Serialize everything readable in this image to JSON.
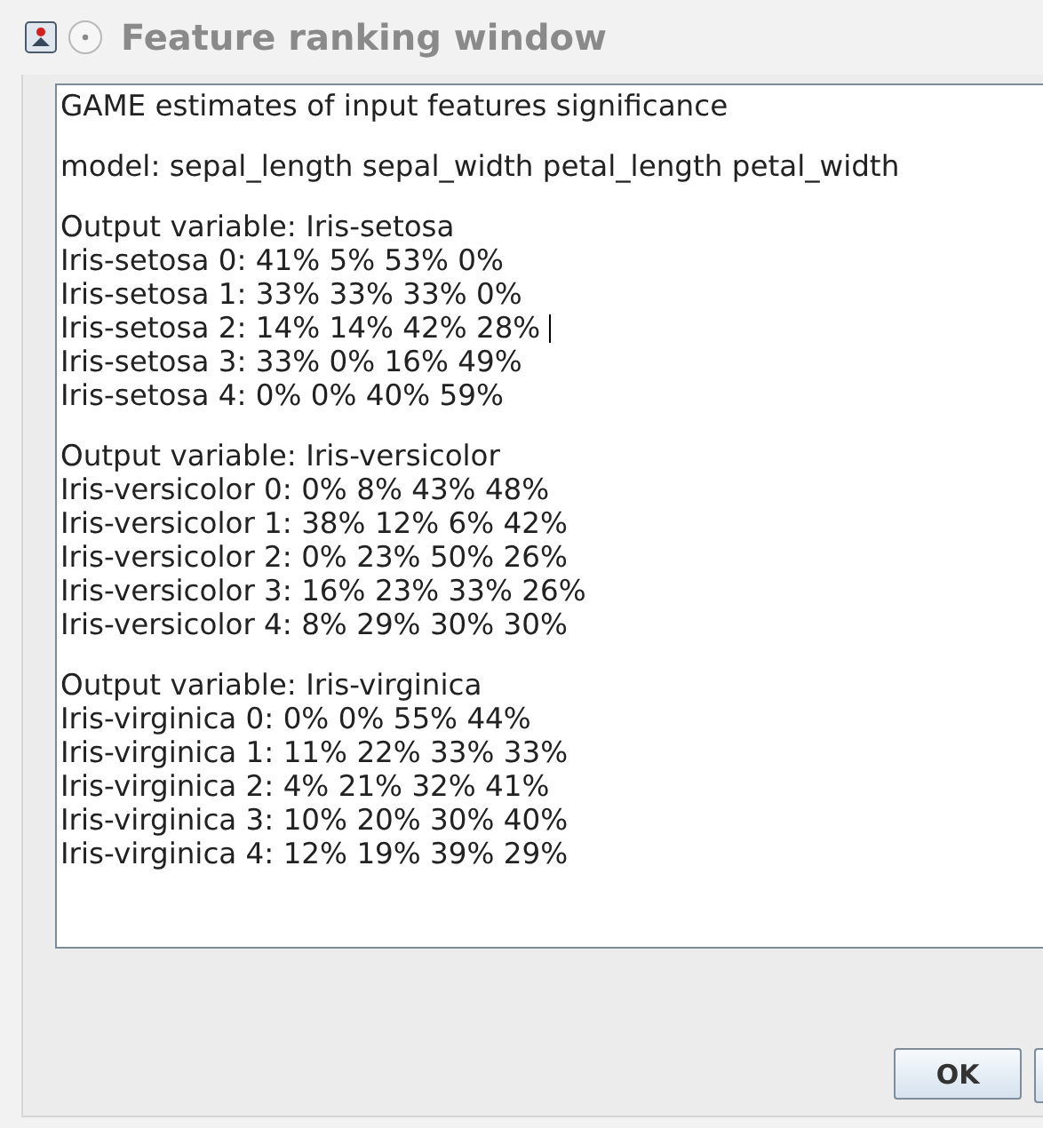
{
  "window": {
    "title": "Feature ranking window"
  },
  "report": {
    "heading": "GAME estimates of input features significance",
    "model": "model: sepal_length sepal_width petal_length petal_width",
    "groups": [
      {
        "title": "Output variable: Iris-setosa",
        "rows": [
          {
            "text": "Iris-setosa 0: 41% 5% 53% 0%",
            "caret": false
          },
          {
            "text": "Iris-setosa 1: 33% 33% 33% 0%",
            "caret": false
          },
          {
            "text": "Iris-setosa 2: 14% 14% 42% 28% ",
            "caret": true
          },
          {
            "text": "Iris-setosa 3: 33% 0% 16% 49%",
            "caret": false
          },
          {
            "text": "Iris-setosa 4: 0% 0% 40% 59%",
            "caret": false
          }
        ]
      },
      {
        "title": "Output variable: Iris-versicolor",
        "rows": [
          {
            "text": "Iris-versicolor 0: 0% 8% 43% 48%",
            "caret": false
          },
          {
            "text": "Iris-versicolor 1: 38% 12% 6% 42%",
            "caret": false
          },
          {
            "text": "Iris-versicolor 2: 0% 23% 50% 26%",
            "caret": false
          },
          {
            "text": "Iris-versicolor 3: 16% 23% 33% 26%",
            "caret": false
          },
          {
            "text": "Iris-versicolor 4: 8% 29% 30% 30%",
            "caret": false
          }
        ]
      },
      {
        "title": "Output variable: Iris-virginica",
        "rows": [
          {
            "text": "Iris-virginica 0: 0% 0% 55% 44%",
            "caret": false
          },
          {
            "text": "Iris-virginica 1: 11% 22% 33% 33%",
            "caret": false
          },
          {
            "text": "Iris-virginica 2: 4% 21% 32% 41%",
            "caret": false
          },
          {
            "text": "Iris-virginica 3: 10% 20% 30% 40%",
            "caret": false
          },
          {
            "text": "Iris-virginica 4: 12% 19% 39% 29%",
            "caret": false
          }
        ]
      }
    ]
  },
  "buttons": [
    "OK"
  ]
}
